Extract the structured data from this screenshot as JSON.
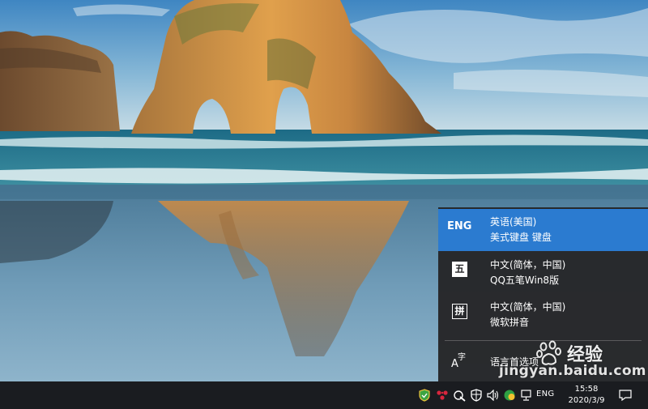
{
  "language_flyout": {
    "items": [
      {
        "code": "ENG",
        "name": "英语(美国)",
        "keyboard": "美式键盘 键盘",
        "selected": true
      },
      {
        "code": "五",
        "name": "中文(简体，中国)",
        "keyboard": "QQ五笔Win8版",
        "selected": false
      },
      {
        "code": "拼",
        "name": "中文(简体，中国)",
        "keyboard": "微软拼音",
        "selected": false
      }
    ],
    "preferences_label": "语言首选项",
    "preferences_icon_text": "字"
  },
  "watermark": {
    "brand": "经验",
    "url": "jingyan.baidu.com"
  },
  "taskbar": {
    "tray": {
      "language": "ENG",
      "time": "15:58",
      "date": "2020/3/9"
    },
    "icons": [
      "shield-icon",
      "network-dots-icon",
      "pen-icon",
      "security-shield-icon",
      "volume-icon",
      "wechat-icon",
      "network-icon",
      "notification-icon"
    ]
  },
  "colors": {
    "selection": "#2b7bd0",
    "flyout_bg": "#262628",
    "taskbar_bg": "#1a1c20"
  }
}
